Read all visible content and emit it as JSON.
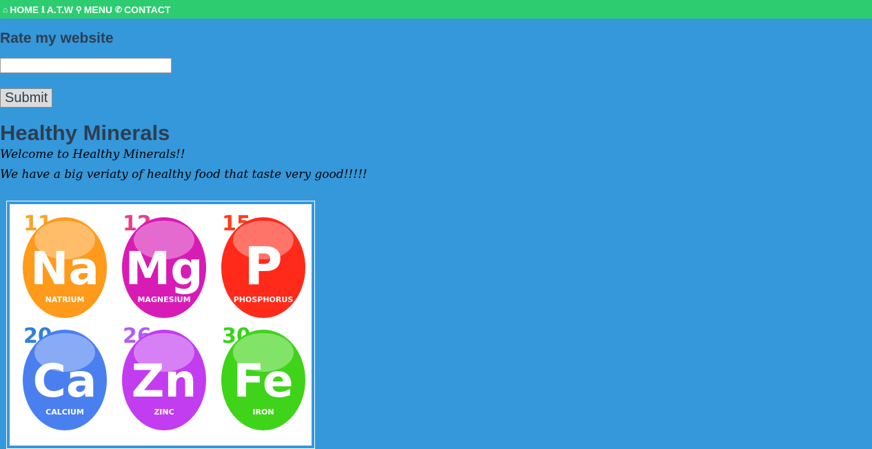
{
  "nav": {
    "items": [
      {
        "icon": "home-icon",
        "label": "HOME"
      },
      {
        "icon": "info-icon",
        "label": "A.T.W"
      },
      {
        "icon": "cutlery-icon",
        "label": "MENU"
      },
      {
        "icon": "phone-icon",
        "label": "CONTACT"
      }
    ]
  },
  "rate": {
    "title": "Rate my website",
    "input_value": "",
    "submit_label": "Submit"
  },
  "content": {
    "title": "Healthy Minerals",
    "line1": "Welcome to Healthy Minerals!!",
    "line2": "We have a big veriaty of healthy food that taste very good!!!!!"
  },
  "minerals": [
    {
      "number": "11",
      "symbol": "Na",
      "name": "NATRIUM",
      "color": "#ff9a1a",
      "numcolor": "#f6a623"
    },
    {
      "number": "12",
      "symbol": "Mg",
      "name": "MAGNESIUM",
      "color": "#d81bb5",
      "numcolor": "#e6408a"
    },
    {
      "number": "15",
      "symbol": "P",
      "name": "PHOSPHORUS",
      "color": "#ff2a1a",
      "numcolor": "#ff3d1a"
    },
    {
      "number": "20",
      "symbol": "Ca",
      "name": "CALCIUM",
      "color": "#4a7ff0",
      "numcolor": "#2f7fe0"
    },
    {
      "number": "26",
      "symbol": "Zn",
      "name": "ZINC",
      "color": "#c23cf0",
      "numcolor": "#b25cf0"
    },
    {
      "number": "30",
      "symbol": "Fe",
      "name": "IRON",
      "color": "#3fd41a",
      "numcolor": "#38d41a"
    }
  ],
  "colors": {
    "background": "#3598db",
    "navbar": "#2ecc71"
  }
}
